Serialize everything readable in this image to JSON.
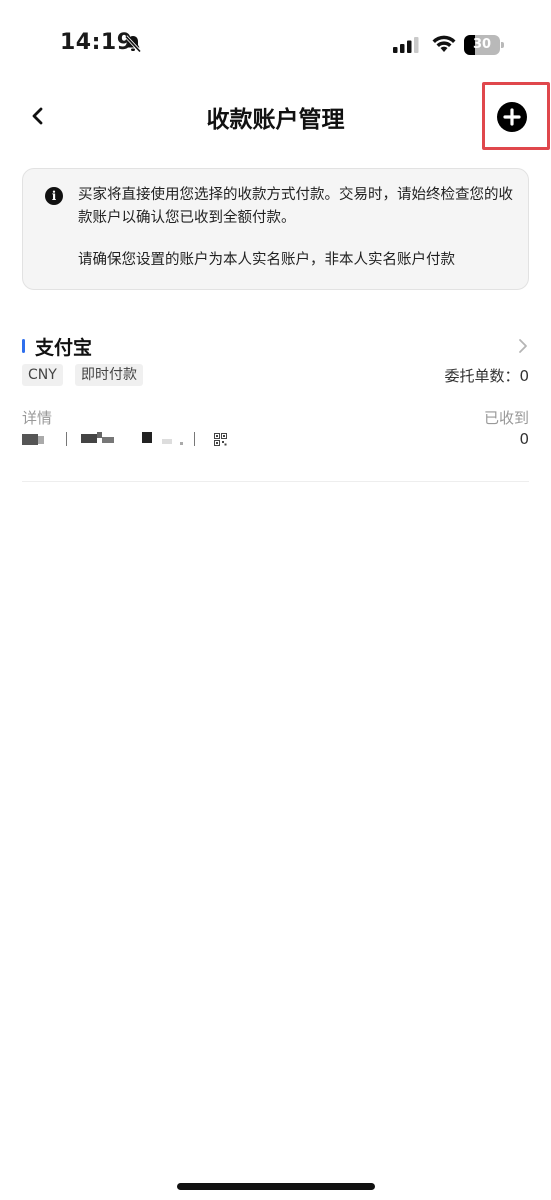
{
  "status_bar": {
    "time": "14:19",
    "battery": "30",
    "battery_level": 0.3
  },
  "nav": {
    "title": "收款账户管理"
  },
  "notice": {
    "line1": "买家将直接使用您选择的收款方式付款。交易时，请始终检查您的收款账户以确认您已收到全额付款。",
    "line2": "请确保您设置的账户为本人实名账户，非本人实名账户付款"
  },
  "account": {
    "name": "支付宝",
    "currency_tag": "CNY",
    "type_tag": "即时付款",
    "orders_label": "委托单数",
    "orders_value": "0",
    "orders_text": "委托单数：0",
    "detail_label": "详情",
    "received_label": "已收到",
    "received_value": "0"
  },
  "colors": {
    "accent": "#2f6fed",
    "highlight": "#e0474c"
  },
  "icons": [
    "back-icon",
    "add-circle-icon",
    "info-icon",
    "chevron-right-icon",
    "qr-code-icon",
    "bell-off-icon",
    "signal-icon",
    "wifi-icon",
    "battery-icon"
  ]
}
